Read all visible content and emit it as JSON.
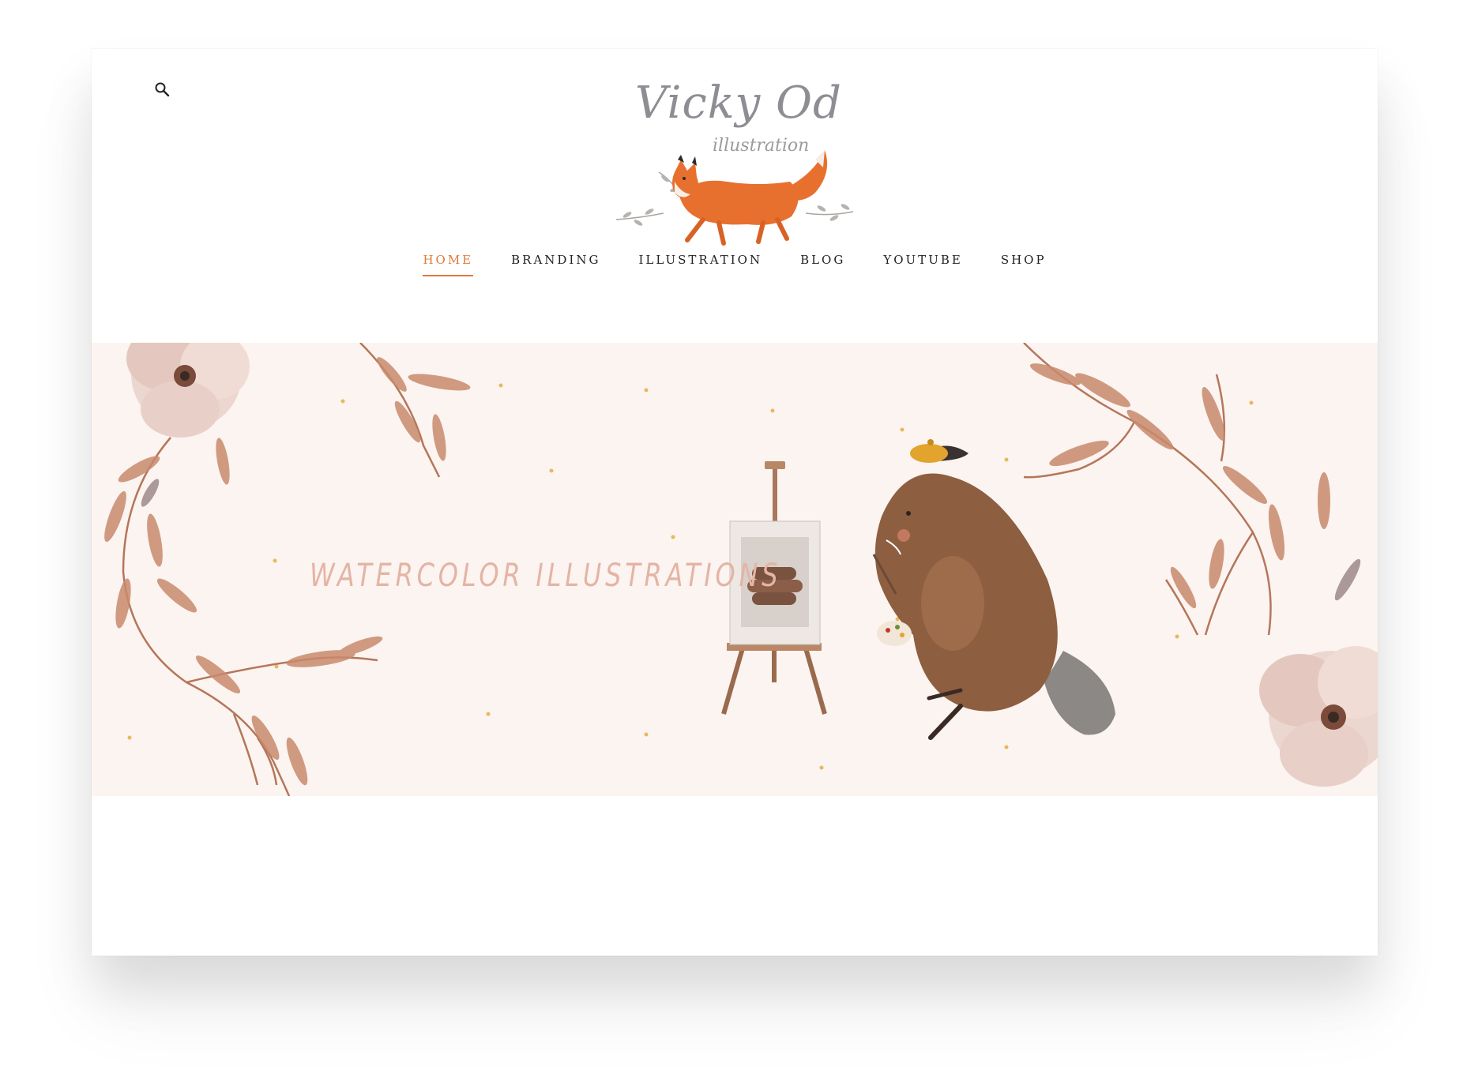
{
  "header": {
    "search_icon": "search-icon",
    "logo": {
      "title": "Vicky Od",
      "subtitle": "illustration"
    }
  },
  "nav": {
    "items": [
      {
        "label": "HOME",
        "active": true
      },
      {
        "label": "BRANDING",
        "active": false
      },
      {
        "label": "ILLUSTRATION",
        "active": false
      },
      {
        "label": "BLOG",
        "active": false
      },
      {
        "label": "YOUTUBE",
        "active": false
      },
      {
        "label": "SHOP",
        "active": false
      }
    ]
  },
  "hero": {
    "headline": "WATERCOLOR ILLUSTRATIONS"
  },
  "colors": {
    "accent": "#e07a3a",
    "hero_background": "#fbf4f1",
    "hero_text": "#e4b4a5"
  }
}
